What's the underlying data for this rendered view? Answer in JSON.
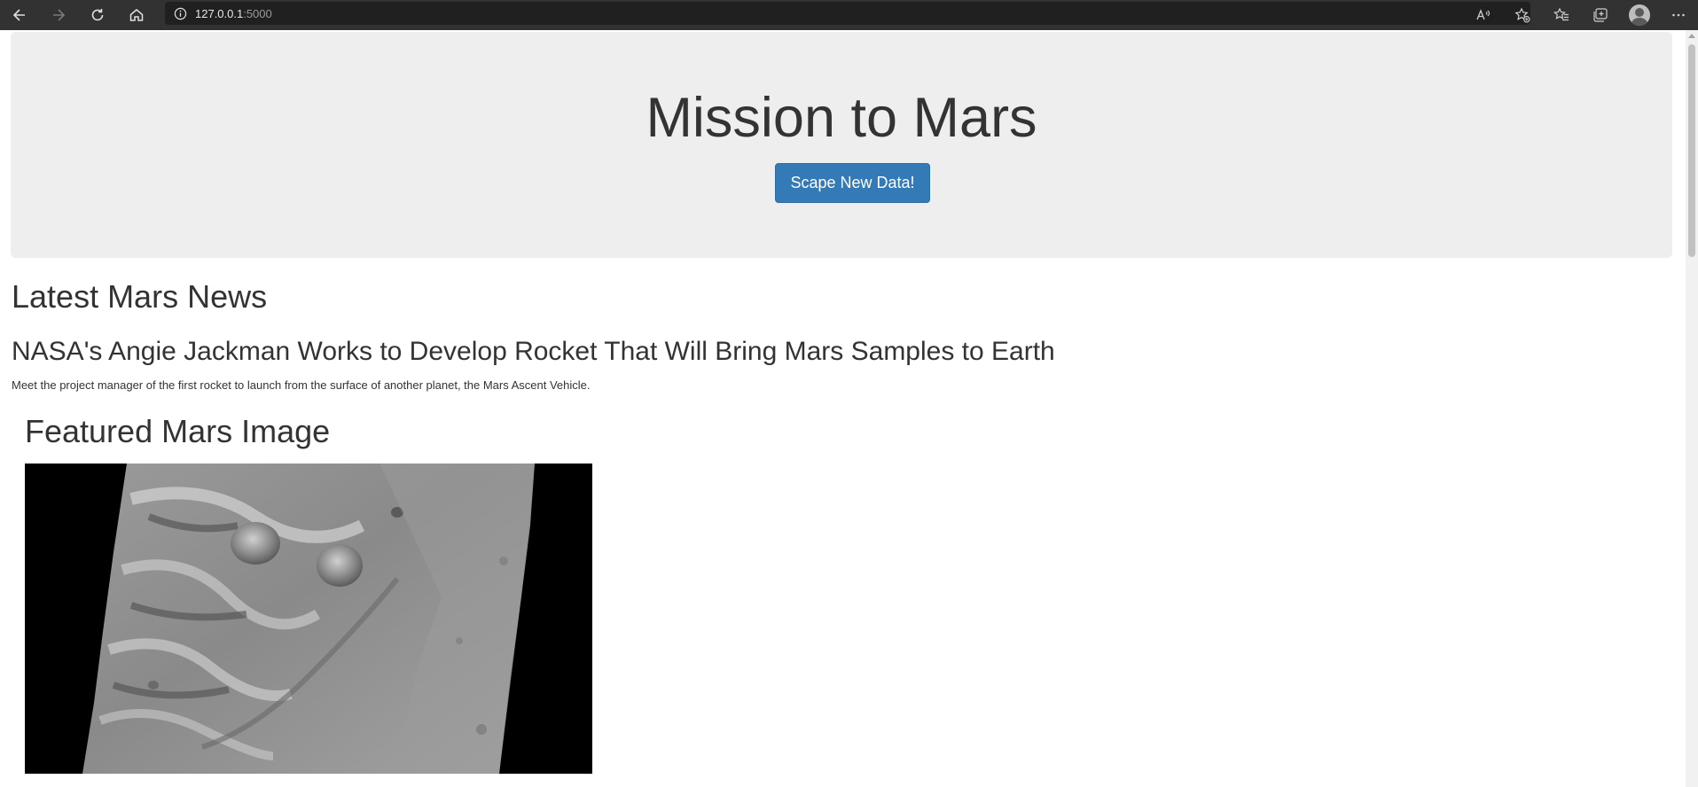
{
  "browser": {
    "url_host": "127.0.0.1",
    "url_port": ":5000",
    "icons": [
      "back-icon",
      "forward-icon",
      "refresh-icon",
      "home-icon",
      "info-icon",
      "read-aloud-icon",
      "add-favorite-icon",
      "favorites-icon",
      "collections-icon",
      "profile-avatar",
      "more-icon"
    ]
  },
  "jumbotron": {
    "title": "Mission to Mars",
    "button_label": "Scape New Data!"
  },
  "news": {
    "heading": "Latest Mars News",
    "title": "NASA's Angie Jackman Works to Develop Rocket That Will Bring Mars Samples to Earth",
    "teaser": "Meet the project manager of the first rocket to launch from the surface of another planet, the Mars Ascent Vehicle."
  },
  "featured": {
    "heading": "Featured Mars Image"
  },
  "colors": {
    "chrome_bg": "#323232",
    "jumbotron_bg": "#eeeeee",
    "button_bg": "#337ab7",
    "text": "#333333"
  }
}
